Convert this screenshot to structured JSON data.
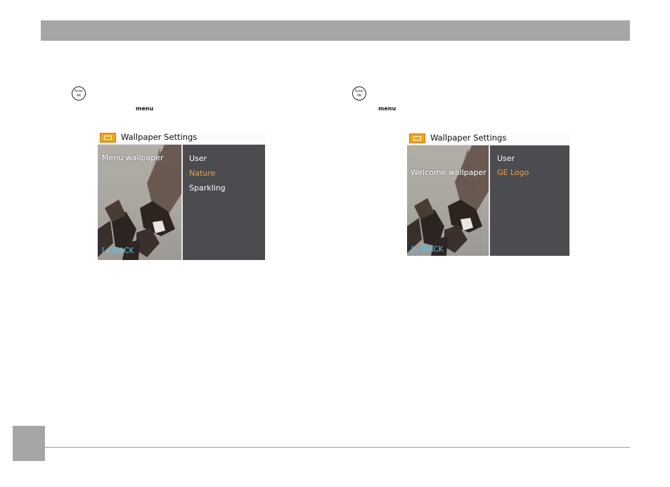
{
  "page": {
    "icons": {
      "func_button": "func-ok-button-icon",
      "wallpaper": "wallpaper-settings-icon",
      "back": "back-arrow-icon"
    },
    "colors": {
      "header_bar": "#a6a6a6",
      "selected_option": "#f2a03a",
      "back_label": "#56c6ee",
      "title_icon": "#f2a516"
    }
  },
  "left_column": {
    "func_button_top": "func",
    "func_button_bottom": "ok",
    "menu_key": "menu",
    "screen": {
      "title": "Wallpaper Settings",
      "label": "Menu wallpaper",
      "options": [
        "User",
        "Nature",
        "Sparkling"
      ],
      "selected": "Nature",
      "back": "BACK"
    }
  },
  "right_column": {
    "func_button_top": "func",
    "func_button_bottom": "ok",
    "menu_key": "menu",
    "screen": {
      "title": "Wallpaper Settings",
      "label": "Welcome wallpaper",
      "options": [
        "User",
        "GE Logo"
      ],
      "selected": "GE Logo",
      "back": "BACK"
    }
  }
}
